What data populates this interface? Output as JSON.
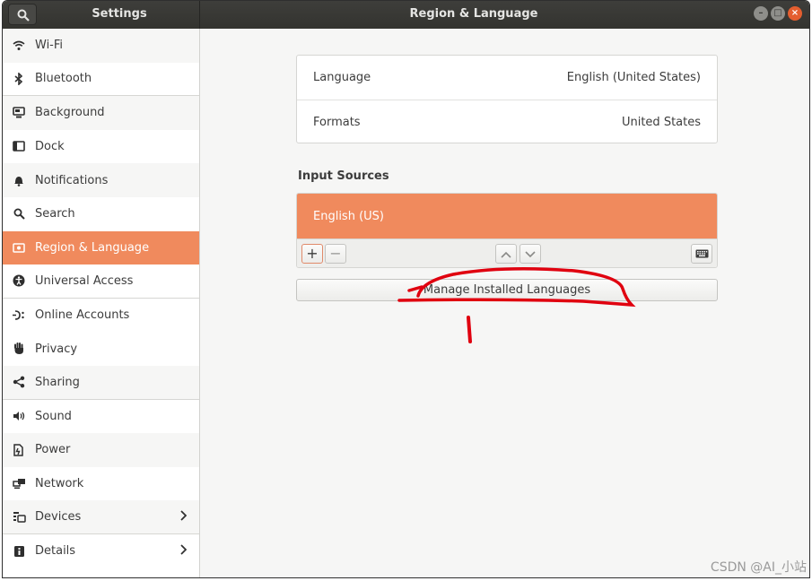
{
  "header": {
    "left_title": "Settings",
    "main_title": "Region & Language"
  },
  "sidebar": {
    "items": [
      {
        "label": "Wi-Fi",
        "icon": "wifi-icon"
      },
      {
        "label": "Bluetooth",
        "icon": "bluetooth-icon"
      },
      {
        "label": "Background",
        "icon": "background-icon"
      },
      {
        "label": "Dock",
        "icon": "dock-icon"
      },
      {
        "label": "Notifications",
        "icon": "bell-icon"
      },
      {
        "label": "Search",
        "icon": "search-icon"
      },
      {
        "label": "Region & Language",
        "icon": "region-icon",
        "active": true
      },
      {
        "label": "Universal Access",
        "icon": "accessibility-icon"
      },
      {
        "label": "Online Accounts",
        "icon": "online-accounts-icon"
      },
      {
        "label": "Privacy",
        "icon": "hand-icon"
      },
      {
        "label": "Sharing",
        "icon": "share-icon"
      },
      {
        "label": "Sound",
        "icon": "speaker-icon"
      },
      {
        "label": "Power",
        "icon": "power-icon"
      },
      {
        "label": "Network",
        "icon": "network-icon"
      },
      {
        "label": "Devices",
        "icon": "devices-icon"
      },
      {
        "label": "Details",
        "icon": "info-icon"
      }
    ]
  },
  "main": {
    "language_label": "Language",
    "language_value": "English (United States)",
    "formats_label": "Formats",
    "formats_value": "United States",
    "input_sources_title": "Input Sources",
    "input_source": "English (US)",
    "add_label": "+",
    "remove_label": "−",
    "manage_label": "Manage Installed Languages"
  },
  "watermark": "CSDN @AI_小站",
  "colors": {
    "accent": "#f08a5d",
    "headerbar": "#3b3b38",
    "annotation": "#e0000f"
  }
}
